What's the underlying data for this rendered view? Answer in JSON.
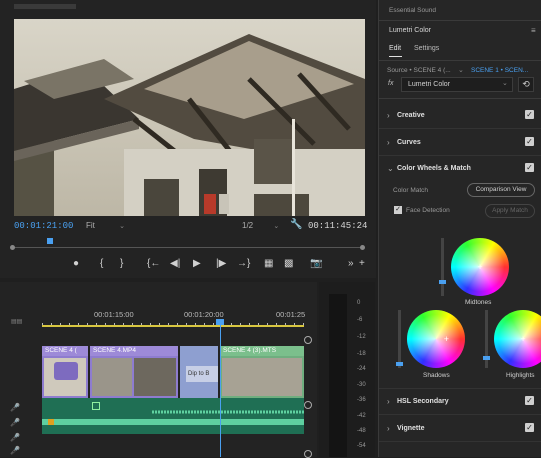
{
  "program_monitor": {
    "timecode_current": "00:01:21:00",
    "timecode_duration": "00:11:45:24",
    "fit_label": "Fit",
    "quality_label": "1/2",
    "transport_icons": [
      "marker-icon",
      "in-point-icon",
      "out-point-icon",
      "go-to-in-icon",
      "step-back-icon",
      "play-icon",
      "step-forward-icon",
      "go-to-out-icon",
      "lift-icon",
      "extract-icon",
      "export-frame-icon",
      "more-icon",
      "add-icon"
    ]
  },
  "timeline": {
    "ruler_labels": [
      "00:01:15:00",
      "00:01:20:00",
      "00:01:25"
    ],
    "clips": [
      {
        "title": "SCENE 4 ("
      },
      {
        "title": "SCENE 4.MP4"
      },
      {
        "title": "SCENE 4 (3).MTS"
      }
    ],
    "text_clip_label": "Dip to B"
  },
  "meters": {
    "db_labels": [
      "0",
      "-6",
      "-12",
      "-18",
      "-24",
      "-30",
      "-36",
      "-42",
      "-48",
      "-54"
    ]
  },
  "lumetri": {
    "top_tab": "Essential Sound",
    "title": "Lumetri Color",
    "tabs": [
      "Edit",
      "Settings"
    ],
    "source_label": "Source • SCENE 4 (...",
    "sequence_label": "SCENE 1 • SCEN...",
    "effect_prefix": "fx",
    "effect_name": "Lumetri Color",
    "sections": {
      "creative": "Creative",
      "curves": "Curves",
      "wheels": "Color Wheels & Match",
      "hsl": "HSL Secondary",
      "vignette": "Vignette"
    },
    "color_match_label": "Color Match",
    "comparison_view_label": "Comparison View",
    "face_detection_label": "Face Detection",
    "apply_match_label": "Apply Match",
    "wheels": {
      "midtones": "Midtones",
      "shadows": "Shadows",
      "highlights": "Highlights"
    },
    "accent_color": "#4aa0f0"
  }
}
